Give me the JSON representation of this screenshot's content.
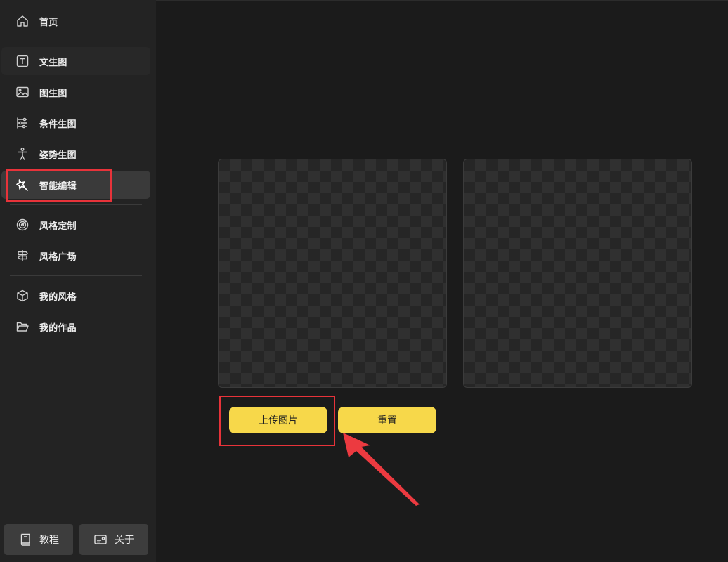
{
  "sidebar": {
    "items": [
      {
        "label": "首页",
        "icon": "home-icon"
      },
      {
        "label": "文生图",
        "icon": "text-box-icon"
      },
      {
        "label": "图生图",
        "icon": "image-icon"
      },
      {
        "label": "条件生图",
        "icon": "sliders-icon"
      },
      {
        "label": "姿势生图",
        "icon": "pose-figure-icon"
      },
      {
        "label": "智能编辑",
        "icon": "magic-wand-icon"
      },
      {
        "label": "风格定制",
        "icon": "target-icon"
      },
      {
        "label": "风格广场",
        "icon": "signpost-icon"
      },
      {
        "label": "我的风格",
        "icon": "cube-icon"
      },
      {
        "label": "我的作品",
        "icon": "folder-open-icon"
      }
    ],
    "active_item": "智能编辑",
    "bottom_buttons": [
      {
        "label": "教程",
        "icon": "book-icon"
      },
      {
        "label": "关于",
        "icon": "info-card-icon"
      }
    ]
  },
  "main": {
    "upload_button": "上传图片",
    "reset_button": "重置"
  },
  "colors": {
    "accent": "#f7d84a",
    "highlight": "#e8333a",
    "background": "#1b1b1b",
    "sidebar": "#232323"
  }
}
